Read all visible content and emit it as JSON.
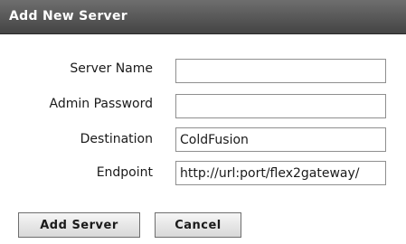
{
  "dialog": {
    "title": "Add New Server"
  },
  "form": {
    "server_name": {
      "label": "Server Name",
      "value": ""
    },
    "admin_password": {
      "label": "Admin Password",
      "value": ""
    },
    "destination": {
      "label": "Destination",
      "value": "ColdFusion"
    },
    "endpoint": {
      "label": "Endpoint",
      "value": "http://url:port/flex2gateway/"
    }
  },
  "buttons": {
    "add_server": "Add Server",
    "cancel": "Cancel"
  }
}
